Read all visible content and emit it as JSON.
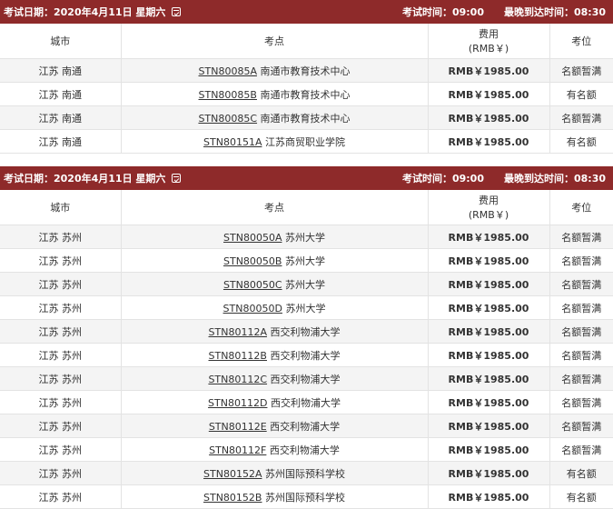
{
  "sections": [
    {
      "exam_date": "考试日期：2020年4月11日 星期六",
      "exam_time": "考试时间：09:00",
      "latest_arrival": "最晚到达时间：08:30",
      "columns": [
        "城市",
        "考点",
        "费用\n(RMB￥)",
        "考位"
      ],
      "fee_header_line1": "费用",
      "fee_header_line2": "(RMB￥)",
      "rows": [
        {
          "city": "江苏 南通",
          "code": "STN80085A",
          "site": " 南通市教育技术中心",
          "fee": "RMB￥1985.00",
          "status": "名额暂满"
        },
        {
          "city": "江苏 南通",
          "code": "STN80085B",
          "site": " 南通市教育技术中心",
          "fee": "RMB￥1985.00",
          "status": "有名额"
        },
        {
          "city": "江苏 南通",
          "code": "STN80085C",
          "site": " 南通市教育技术中心",
          "fee": "RMB￥1985.00",
          "status": "名额暂满"
        },
        {
          "city": "江苏 南通",
          "code": "STN80151A",
          "site": " 江苏商贸职业学院",
          "fee": "RMB￥1985.00",
          "status": "有名额"
        }
      ]
    },
    {
      "exam_date": "考试日期：2020年4月11日 星期六",
      "exam_time": "考试时间：09:00",
      "latest_arrival": "最晚到达时间：08:30",
      "fee_header_line1": "费用",
      "fee_header_line2": "(RMB￥)",
      "columns": [
        "城市",
        "考点",
        "费用\n(RMB￥)",
        "考位"
      ],
      "rows": [
        {
          "city": "江苏 苏州",
          "code": "STN80050A",
          "site": " 苏州大学",
          "fee": "RMB￥1985.00",
          "status": "名额暂满"
        },
        {
          "city": "江苏 苏州",
          "code": "STN80050B",
          "site": " 苏州大学",
          "fee": "RMB￥1985.00",
          "status": "名额暂满"
        },
        {
          "city": "江苏 苏州",
          "code": "STN80050C",
          "site": " 苏州大学",
          "fee": "RMB￥1985.00",
          "status": "名额暂满"
        },
        {
          "city": "江苏 苏州",
          "code": "STN80050D",
          "site": " 苏州大学",
          "fee": "RMB￥1985.00",
          "status": "名额暂满"
        },
        {
          "city": "江苏 苏州",
          "code": "STN80112A",
          "site": " 西交利物浦大学",
          "fee": "RMB￥1985.00",
          "status": "名额暂满"
        },
        {
          "city": "江苏 苏州",
          "code": "STN80112B",
          "site": " 西交利物浦大学",
          "fee": "RMB￥1985.00",
          "status": "名额暂满"
        },
        {
          "city": "江苏 苏州",
          "code": "STN80112C",
          "site": " 西交利物浦大学",
          "fee": "RMB￥1985.00",
          "status": "名额暂满"
        },
        {
          "city": "江苏 苏州",
          "code": "STN80112D",
          "site": " 西交利物浦大学",
          "fee": "RMB￥1985.00",
          "status": "名额暂满"
        },
        {
          "city": "江苏 苏州",
          "code": "STN80112E",
          "site": " 西交利物浦大学",
          "fee": "RMB￥1985.00",
          "status": "名额暂满"
        },
        {
          "city": "江苏 苏州",
          "code": "STN80112F",
          "site": " 西交利物浦大学",
          "fee": "RMB￥1985.00",
          "status": "名额暂满"
        },
        {
          "city": "江苏 苏州",
          "code": "STN80152A",
          "site": " 苏州国际预科学校",
          "fee": "RMB￥1985.00",
          "status": "有名额"
        },
        {
          "city": "江苏 苏州",
          "code": "STN80152B",
          "site": " 苏州国际预科学校",
          "fee": "RMB￥1985.00",
          "status": "有名额"
        }
      ]
    }
  ],
  "colors": {
    "bar": "#8e2a2a",
    "row_alt": "#f4f4f4",
    "border": "#e3e3e3"
  },
  "icons": {
    "calendar": "calendar-icon"
  }
}
